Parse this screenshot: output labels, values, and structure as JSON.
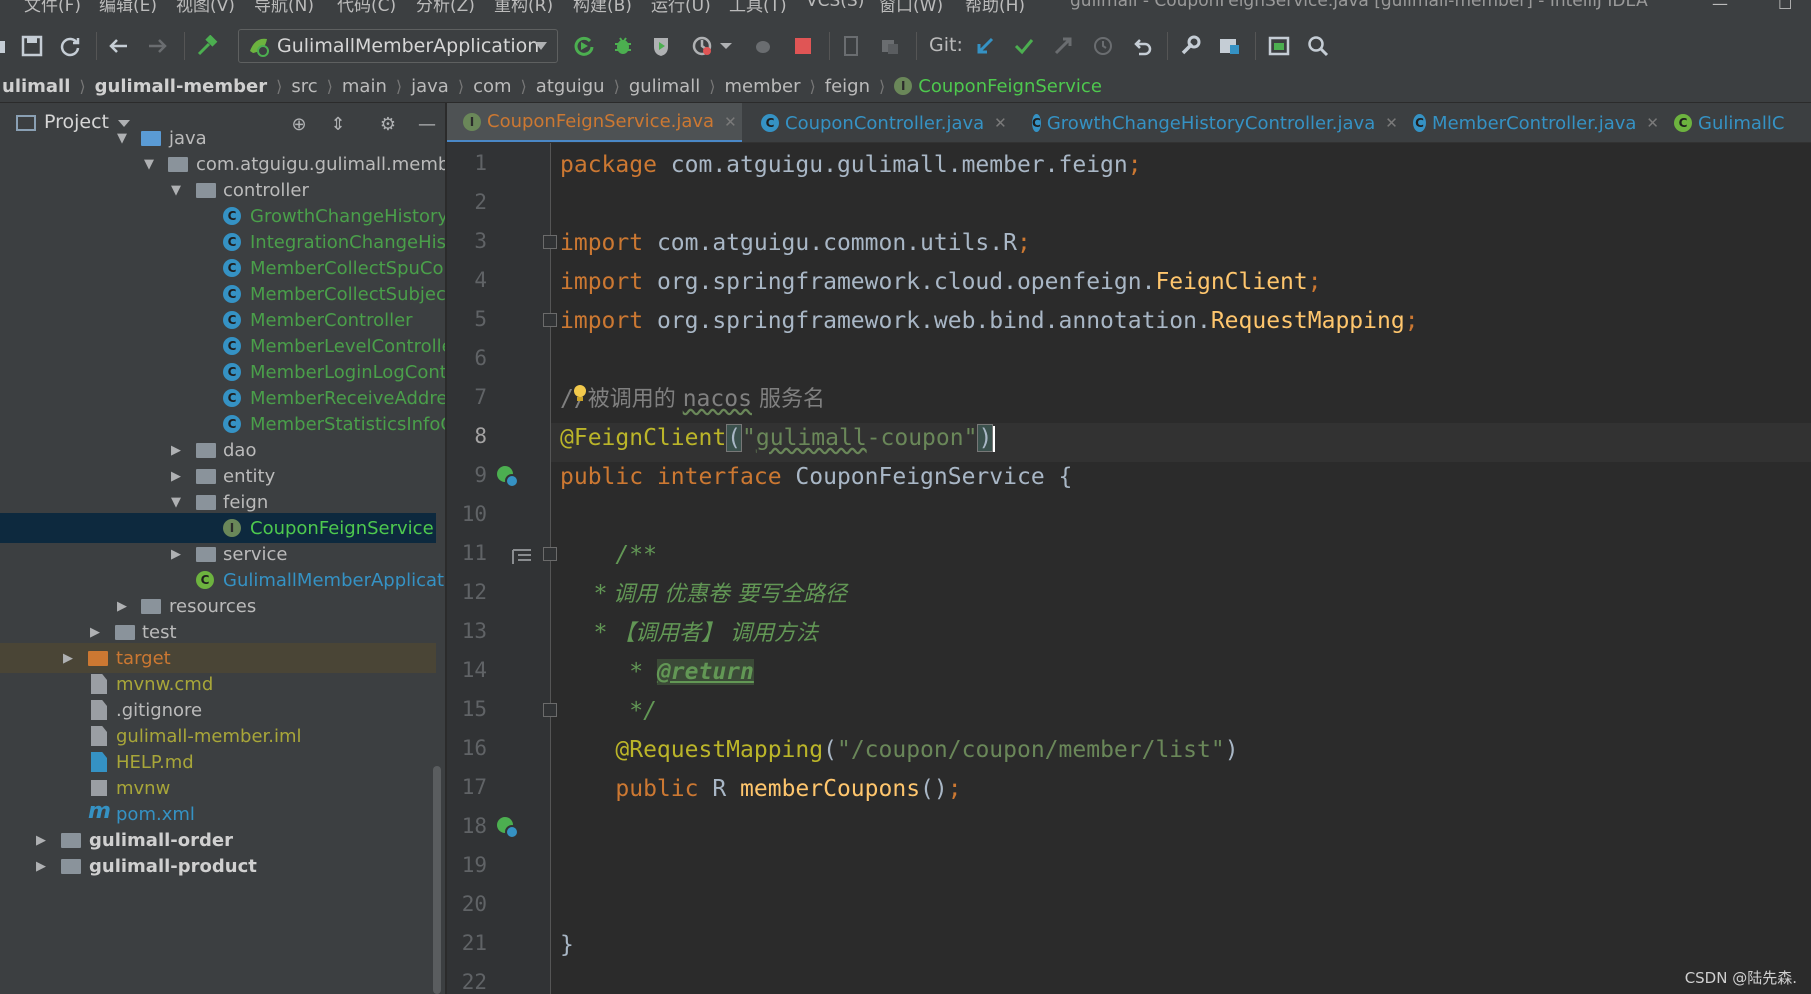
{
  "menubar": {
    "items": [
      "文件(F)",
      "编辑(E)",
      "视图(V)",
      "导航(N)",
      "代码(C)",
      "分析(Z)",
      "重构(R)",
      "构建(B)",
      "运行(U)",
      "工具(T)",
      "VCS(S)",
      "窗口(W)",
      "帮助(H)"
    ],
    "window_title": "gulimall - CouponFeignService.java [gulimall-member] - IntelliJ IDEA"
  },
  "toolbar": {
    "run_config": "GulimallMemberApplication",
    "git_label": "Git:"
  },
  "breadcrumb": [
    "ulimall",
    "gulimall-member",
    "src",
    "main",
    "java",
    "com",
    "atguigu",
    "gulimall",
    "member",
    "feign",
    "CouponFeignService"
  ],
  "project": {
    "title": "Project",
    "tree": [
      "java",
      "com.atguigu.gulimall.member",
      "controller",
      "GrowthChangeHistoryController",
      "IntegrationChangeHistoryController",
      "MemberCollectSpuController",
      "MemberCollectSubjectController",
      "MemberController",
      "MemberLevelController",
      "MemberLoginLogController",
      "MemberReceiveAddressController",
      "MemberStatisticsInfoController",
      "dao",
      "entity",
      "feign",
      "CouponFeignService",
      "service",
      "GulimallMemberApplication",
      "resources",
      "test",
      "target",
      "mvnw.cmd",
      ".gitignore",
      "gulimall-member.iml",
      "HELP.md",
      "mvnw",
      "pom.xml",
      "gulimall-order",
      "gulimall-product"
    ]
  },
  "tabs": [
    "CouponFeignService.java",
    "CouponController.java",
    "GrowthChangeHistoryController.java",
    "MemberController.java",
    "GulimallC"
  ],
  "editor": {
    "line_numbers": [
      "1",
      "2",
      "3",
      "4",
      "5",
      "6",
      "7",
      "8",
      "9",
      "10",
      "11",
      "12",
      "13",
      "14",
      "15",
      "16",
      "17",
      "18",
      "19",
      "20",
      "21",
      "22"
    ],
    "current_line": "8",
    "code": {
      "l1_kw": "package ",
      "l1_rest": "com.atguigu.gulimall.member.feign",
      "l1_semi": ";",
      "import_kw": "import ",
      "l3_rest": "com.atguigu.common.utils.R",
      "l4_rest": "org.springframework.cloud.openfeign.",
      "l4_cls": "FeignClient",
      "l5_rest": "org.springframework.web.bind.annotation.",
      "l5_cls": "RequestMapping",
      "semi": ";",
      "l7_slash": "//",
      "l7_text1": "被调用的 ",
      "l7_nacos": "nacos",
      "l7_text2": " 服务名",
      "l8_ann": "@FeignClient",
      "l8_open": "(",
      "l8_str_q1": "\"",
      "l8_str_body": "gulimall",
      "l8_str_tail": "-coupon\"",
      "l8_close": ")",
      "l9_public": "public ",
      "l9_interface": "interface ",
      "l9_name": "CouponFeignService ",
      "l9_brace": "{",
      "l11": "    /**",
      "l12": "     * 调用 优惠卷 要写全路径",
      "l13": "     * 【调用者】 调用方法",
      "l14_star": "     * ",
      "l14_tag": "@return",
      "l15": "     */",
      "l16_ann": "    @RequestMapping",
      "l16_open": "(",
      "l16_str": "\"/coupon/coupon/member/list\"",
      "l16_close": ")",
      "l17_public": "    public ",
      "l17_type": "R ",
      "l17_method": "memberCoupons",
      "l17_parens": "()",
      "l17_semi": ";",
      "l21": "}"
    }
  },
  "watermark": "CSDN @陆先森."
}
